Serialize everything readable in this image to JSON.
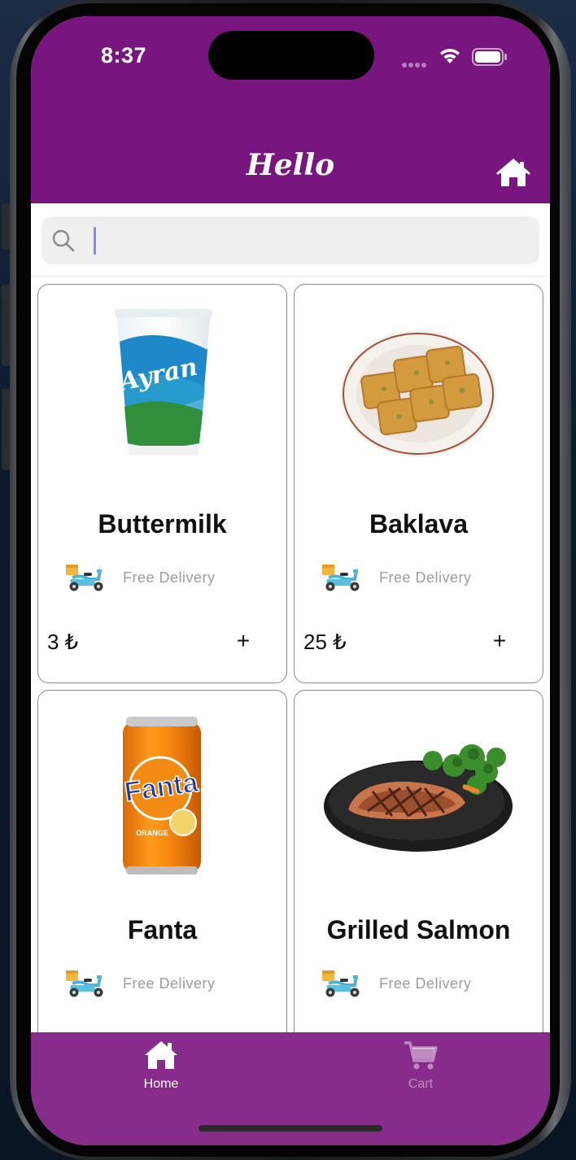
{
  "status_bar": {
    "time": "8:37"
  },
  "header": {
    "title": "Hello"
  },
  "search": {
    "value": "",
    "placeholder": ""
  },
  "products": [
    {
      "name": "Buttermilk",
      "delivery": "Free Delivery",
      "price": "3 ₺",
      "add": "+",
      "image": "ayran-cup"
    },
    {
      "name": "Baklava",
      "delivery": "Free Delivery",
      "price": "25 ₺",
      "add": "+",
      "image": "baklava-plate"
    },
    {
      "name": "Fanta",
      "delivery": "Free Delivery",
      "price": "",
      "add": "",
      "image": "fanta-can"
    },
    {
      "name": "Grilled Salmon",
      "delivery": "Free Delivery",
      "price": "",
      "add": "",
      "image": "salmon-plate"
    }
  ],
  "tabs": [
    {
      "label": "Home",
      "icon": "home-icon",
      "active": true
    },
    {
      "label": "Cart",
      "icon": "cart-icon",
      "active": false
    }
  ],
  "colors": {
    "header": "#79157f",
    "tabbar": "#882c8b",
    "active_tab": "#ffffff",
    "inactive_tab": "#c08fc2"
  }
}
